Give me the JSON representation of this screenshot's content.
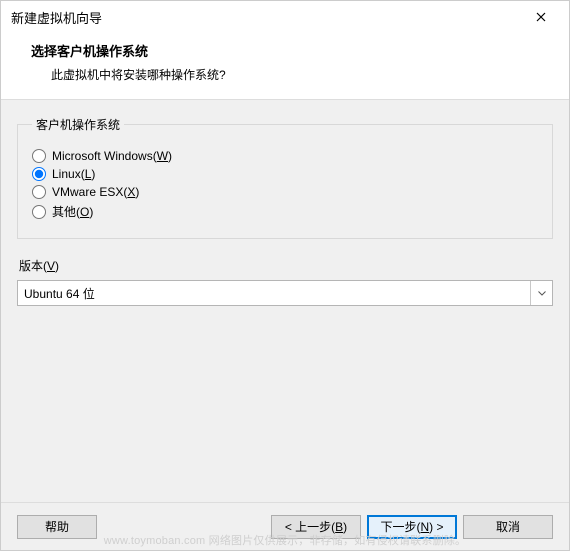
{
  "window": {
    "title": "新建虚拟机向导"
  },
  "header": {
    "headline": "选择客户机操作系统",
    "sub": "此虚拟机中将安装哪种操作系统?"
  },
  "os_group": {
    "legend": "客户机操作系统",
    "items": [
      {
        "pre": "Microsoft Windows(",
        "key": "W",
        "post": ")",
        "checked": false
      },
      {
        "pre": "Linux(",
        "key": "L",
        "post": ")",
        "checked": true
      },
      {
        "pre": "VMware ESX(",
        "key": "X",
        "post": ")",
        "checked": false
      },
      {
        "pre": "其他(",
        "key": "O",
        "post": ")",
        "checked": false
      }
    ]
  },
  "version": {
    "label_pre": "版本(",
    "label_key": "V",
    "label_post": ")",
    "selected": "Ubuntu 64 位"
  },
  "footer": {
    "help": "帮助",
    "back_pre": "< 上一步(",
    "back_key": "B",
    "back_post": ")",
    "next_pre": "下一步(",
    "next_key": "N",
    "next_post": ") >",
    "cancel": "取消"
  },
  "watermark": "www.toymoban.com 网络图片仅供展示，非存储，如有侵权请联系删除。"
}
